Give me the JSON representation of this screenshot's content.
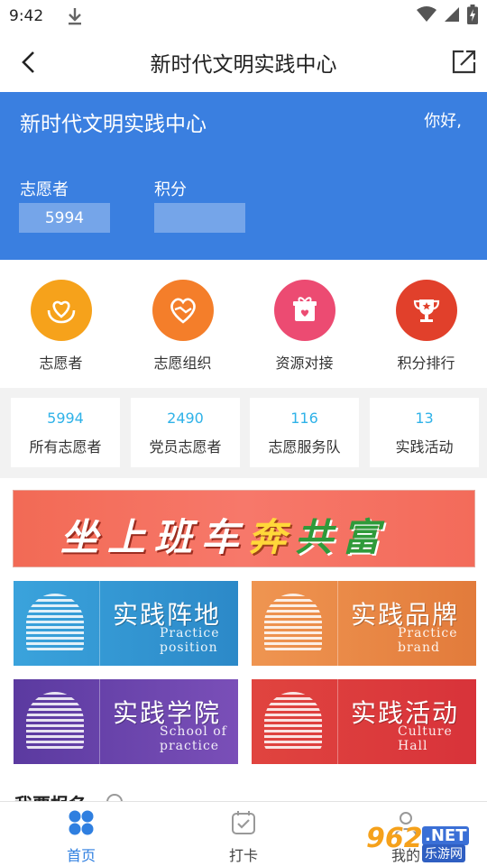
{
  "status_bar": {
    "time": "9:42"
  },
  "nav": {
    "title": "新时代文明实践中心"
  },
  "hero": {
    "title": "新时代文明实践中心",
    "greeting": "你好,",
    "volunteer_label": "志愿者",
    "volunteer_value": "5994",
    "points_label": "积分",
    "points_value": ""
  },
  "menu": [
    {
      "label": "志愿者",
      "icon": "heart-hands-icon",
      "color": "#f6a21b"
    },
    {
      "label": "志愿组织",
      "icon": "heart-handshake-icon",
      "color": "#f47e2a"
    },
    {
      "label": "资源对接",
      "icon": "gift-icon",
      "color": "#ec4b72"
    },
    {
      "label": "积分排行",
      "icon": "trophy-icon",
      "color": "#e1402b"
    }
  ],
  "stats": [
    {
      "value": "5994",
      "name": "所有志愿者"
    },
    {
      "value": "2490",
      "name": "党员志愿者"
    },
    {
      "value": "116",
      "name": "志愿服务队"
    },
    {
      "value": "13",
      "name": "实践活动"
    }
  ],
  "banner": {
    "part1": "坐上班车",
    "part2": "奔",
    "part3": "共富"
  },
  "tiles": [
    {
      "cn": "实践阵地",
      "en1": "Practice",
      "en2": "position",
      "color1": "#3aa3dc",
      "color2": "#2c89c8"
    },
    {
      "cn": "实践品牌",
      "en1": "Practice",
      "en2": "brand",
      "color1": "#ef9551",
      "color2": "#e27b3b"
    },
    {
      "cn": "实践学院",
      "en1": "School of",
      "en2": "practice",
      "color1": "#5b3aa0",
      "color2": "#7a4fb8"
    },
    {
      "cn": "实践活动",
      "en1": "Culture",
      "en2": "Hall",
      "color1": "#e0443f",
      "color2": "#d8333a"
    }
  ],
  "section": {
    "title": "我要报名"
  },
  "tabbar": [
    {
      "label": "首页",
      "icon": "home-grid-icon",
      "active": true
    },
    {
      "label": "打卡",
      "icon": "checkin-calendar-icon",
      "active": false
    },
    {
      "label": "我的",
      "icon": "user-icon",
      "active": false
    }
  ],
  "watermark": {
    "num": "962",
    "net": ".NET",
    "cn": "乐游网"
  },
  "colors": {
    "primary": "#3a7fe0",
    "stat_number": "#2fb2e8",
    "tab_active": "#2f7fe0"
  }
}
